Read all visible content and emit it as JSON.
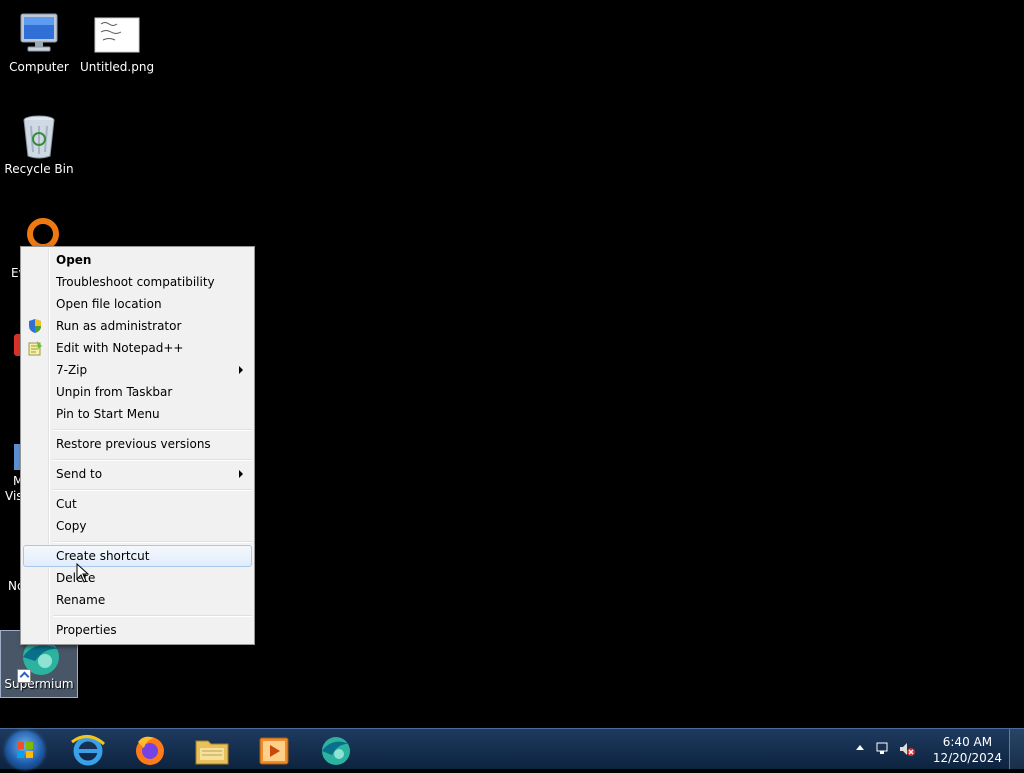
{
  "desktop": {
    "icons": [
      {
        "label": "Computer"
      },
      {
        "label": "Untitled.png"
      },
      {
        "label": "Recycle Bin"
      },
      {
        "label": "Supermium"
      }
    ],
    "partial_labels": [
      "Ev",
      "M",
      "Vis",
      "No"
    ]
  },
  "context_menu": {
    "items": [
      {
        "label": "Open",
        "bold": true
      },
      {
        "label": "Troubleshoot compatibility"
      },
      {
        "label": "Open file location"
      },
      {
        "label": "Run as administrator",
        "icon": "uac-shield-icon"
      },
      {
        "label": "Edit with Notepad++",
        "icon": "notepad-plus-plus-icon"
      },
      {
        "label": "7-Zip",
        "submenu": true
      },
      {
        "label": "Unpin from Taskbar"
      },
      {
        "label": "Pin to Start Menu"
      },
      {
        "label": "Restore previous versions"
      },
      {
        "label": "Send to",
        "submenu": true
      },
      {
        "label": "Cut"
      },
      {
        "label": "Copy"
      },
      {
        "label": "Create shortcut",
        "highlighted": true
      },
      {
        "label": "Delete"
      },
      {
        "label": "Rename"
      },
      {
        "label": "Properties"
      }
    ]
  },
  "taskbar": {
    "pinned": [
      "start-orb-icon",
      "internet-explorer-icon",
      "firefox-icon",
      "file-explorer-icon",
      "media-player-icon",
      "supermium-icon"
    ],
    "clock": {
      "time": "6:40 AM",
      "date": "12/20/2024"
    }
  },
  "colors": {
    "taskbar": "#1e3a5f",
    "menu_bg": "#f1f1f1",
    "highlight_border": "#a8c8eb"
  }
}
